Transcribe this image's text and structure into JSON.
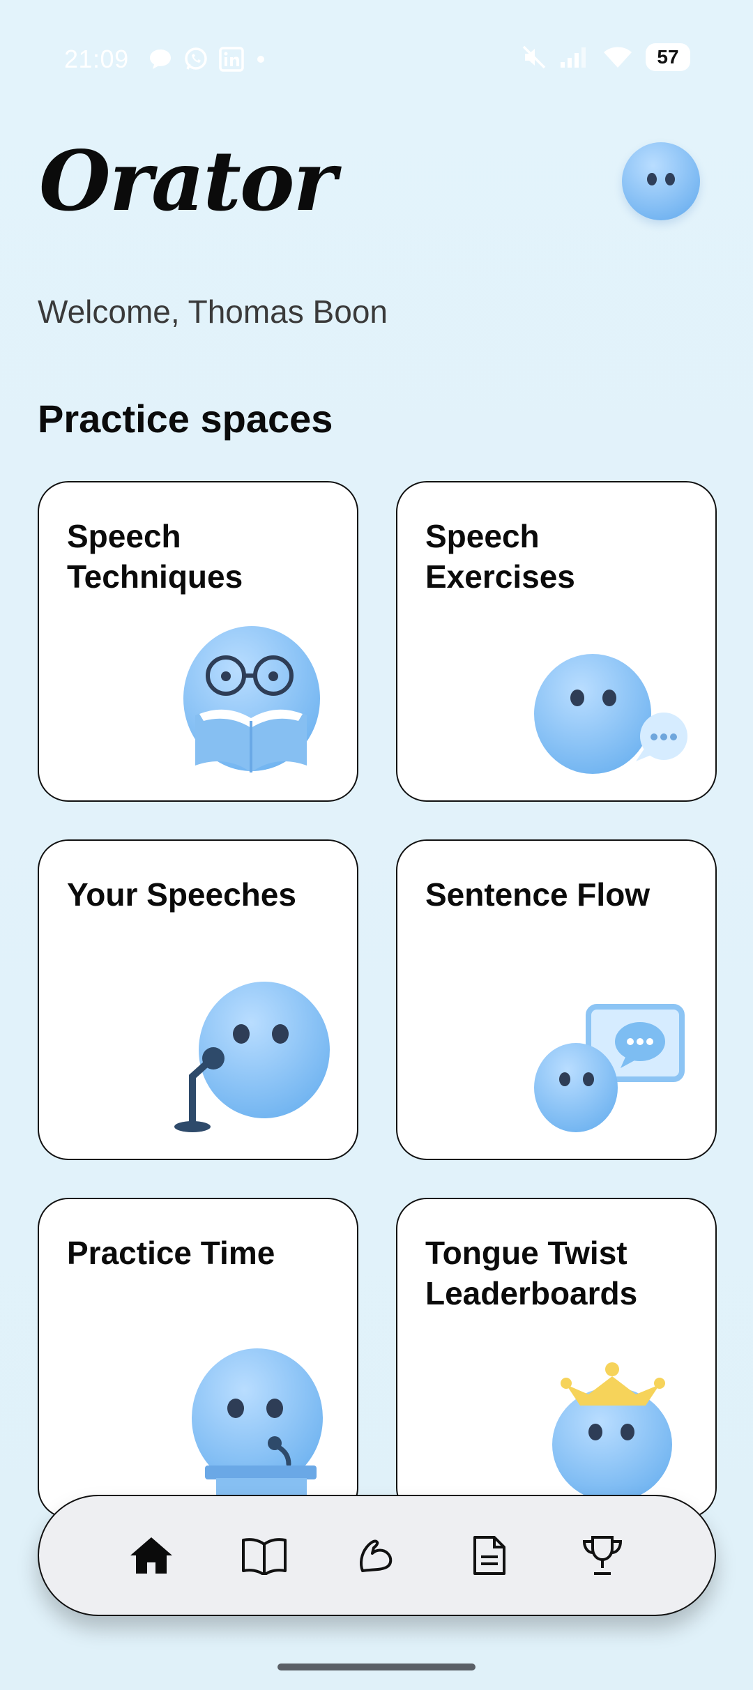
{
  "status_bar": {
    "time": "21:09",
    "left_icons": [
      "chat-bubble-icon",
      "whatsapp-icon",
      "linkedin-icon",
      "dot-icon"
    ],
    "right_icons": [
      "mute-icon",
      "signal-icon",
      "wifi-icon"
    ],
    "battery": "57"
  },
  "header": {
    "app_name": "Orator",
    "welcome": "Welcome, Thomas Boon"
  },
  "section": {
    "title": "Practice spaces"
  },
  "cards": [
    {
      "title": "Speech Techniques",
      "icon": "reading-blob-icon"
    },
    {
      "title": "Speech Exercises",
      "icon": "speaking-blob-icon"
    },
    {
      "title": "Your Speeches",
      "icon": "microphone-blob-icon"
    },
    {
      "title": "Sentence Flow",
      "icon": "chat-window-blob-icon"
    },
    {
      "title": "Practice Time",
      "icon": "podium-blob-icon"
    },
    {
      "title": "Tongue Twist Leaderboards",
      "icon": "crown-blob-icon"
    }
  ],
  "bottom_nav": {
    "items": [
      "home-icon",
      "book-icon",
      "flex-arm-icon",
      "document-icon",
      "trophy-icon"
    ],
    "active": "home-icon"
  },
  "colors": {
    "background": "#e2f2fa",
    "blob": "#8cc4f4",
    "blob_dark": "#5aa3e8",
    "eye": "#2f3f5a",
    "accent_dark": "#2e4a6a",
    "crown": "#f6d35a"
  }
}
